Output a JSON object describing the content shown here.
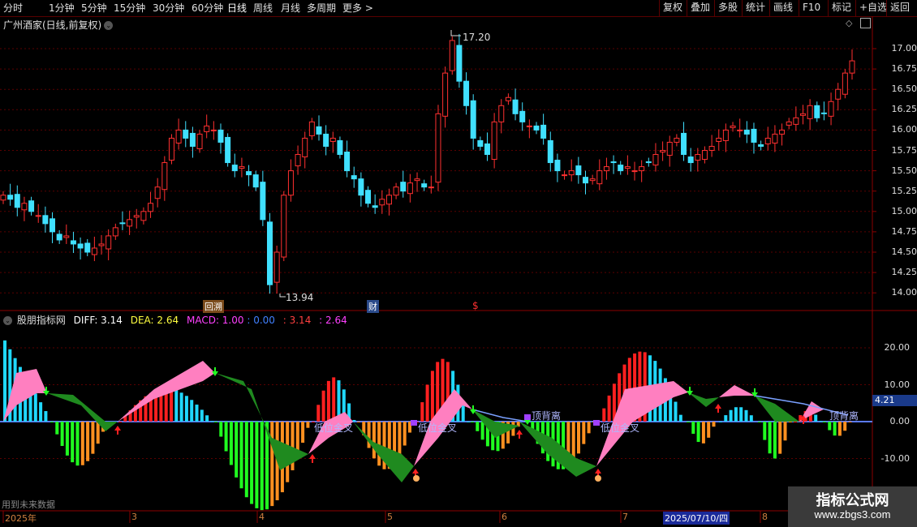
{
  "toolbar": {
    "periods": [
      "分时",
      "1分钟",
      "5分钟",
      "15分钟",
      "30分钟",
      "60分钟",
      "日线",
      "周线",
      "月线",
      "多周期",
      "更多 >"
    ],
    "active_period": "日线",
    "right_buttons": [
      "复权",
      "叠加",
      "多股",
      "统计",
      "画线",
      "F10",
      "标记",
      "+自选",
      "返回"
    ]
  },
  "chart_title": "广州酒家(日线,前复权)",
  "price_axis": [
    "17.00",
    "16.75",
    "16.50",
    "16.25",
    "16.00",
    "15.75",
    "15.50",
    "15.25",
    "15.00",
    "14.75",
    "14.50",
    "14.25",
    "14.00"
  ],
  "price_high_label": "17.20",
  "price_low_label": "13.94",
  "event_tags": [
    "回溯",
    "财",
    "$"
  ],
  "indicator": {
    "name": "股朋指标网",
    "diff": "DIFF: 3.14",
    "dea": "DEA: 2.64",
    "macd": "MACD: 1.00",
    "v1": ": 0.00",
    "v2": ": 3.14",
    "v3": ": 2.64",
    "axis": [
      "20.00",
      "10.00",
      "0.00",
      "-10.00"
    ],
    "current_value": "4.21",
    "annotations": [
      "低位金叉",
      "低位金叉",
      "顶背离",
      "低位金叉",
      "顶背离"
    ],
    "colors": {
      "up": "#ff2020",
      "down": "#20d8ff",
      "pink": "#ff7fc0",
      "green": "#1f8a1f",
      "orange": "#ff9020",
      "lime": "#20ff20"
    }
  },
  "date_axis": [
    "2025年",
    "3",
    "4",
    "5",
    "6",
    "7",
    "2025/07/10/四",
    "8"
  ],
  "future_note": "用到未来数据",
  "watermark": {
    "title": "指标公式网",
    "url": "www.zbgs3.com"
  },
  "chart_data": {
    "type": "candlestick",
    "ylim": [
      13.8,
      17.2
    ],
    "price_series": [
      15.2,
      15.15,
      15.05,
      15.1,
      15.0,
      14.95,
      14.85,
      14.75,
      14.65,
      14.7,
      14.6,
      14.55,
      14.5,
      14.55,
      14.6,
      14.7,
      14.8,
      14.85,
      14.9,
      14.95,
      15.0,
      15.1,
      15.3,
      15.6,
      15.9,
      16.0,
      15.9,
      15.8,
      15.95,
      16.05,
      16.0,
      15.85,
      15.6,
      15.5,
      15.55,
      15.45,
      15.3,
      14.9,
      14.1,
      14.5,
      15.2,
      15.5,
      15.7,
      15.9,
      16.1,
      15.95,
      15.8,
      15.9,
      15.7,
      15.5,
      15.4,
      15.2,
      15.1,
      15.05,
      15.15,
      15.2,
      15.3,
      15.25,
      15.35,
      15.4,
      15.3,
      15.3,
      16.2,
      16.7,
      17.1,
      16.6,
      16.3,
      15.9,
      15.8,
      15.7,
      16.1,
      16.3,
      16.4,
      16.2,
      16.1,
      16.05,
      16.0,
      15.9,
      15.6,
      15.5,
      15.45,
      15.5,
      15.45,
      15.35,
      15.4,
      15.5,
      15.55,
      15.6,
      15.5,
      15.55,
      15.5,
      15.55,
      15.6,
      15.7,
      15.75,
      15.85,
      15.9,
      15.7,
      15.6,
      15.7,
      15.75,
      15.8,
      15.9,
      16.0,
      16.05,
      16.0,
      15.95,
      15.85,
      15.8,
      15.9,
      15.95,
      16.0,
      16.1,
      16.15,
      16.2,
      16.3,
      16.15,
      16.2,
      16.35,
      16.5,
      16.7,
      16.85
    ]
  }
}
